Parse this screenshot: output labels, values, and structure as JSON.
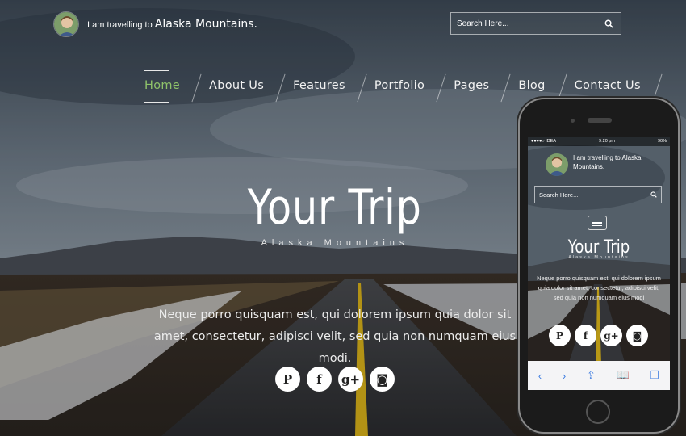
{
  "header": {
    "brand_prefix": "I am travelling to",
    "brand_strong": "Alaska Mountains.",
    "search_placeholder": "Search Here..."
  },
  "nav": {
    "items": [
      "Home",
      "About Us",
      "Features",
      "Portfolio",
      "Pages",
      "Blog",
      "Contact Us"
    ],
    "active": "Home"
  },
  "hero": {
    "title": "Your Trip",
    "subtitle": "Alaska Mountains",
    "lead": "Neque porro quisquam est, qui dolorem ipsum quia dolor sit amet, consectetur, adipisci velit, sed quia non numquam eius modi."
  },
  "social": {
    "icons": [
      "pinterest-icon",
      "facebook-icon",
      "google-plus-icon",
      "instagram-icon"
    ],
    "glyphs": [
      "P",
      "f",
      "g+",
      "◙"
    ]
  },
  "phone": {
    "status_carrier": "●●●●○ IDEA",
    "status_time": "9:20 pm",
    "status_battery": "90%",
    "brand_prefix": "I am travelling to",
    "brand_strong": "Alaska Mountains.",
    "search_placeholder": "Search Here...",
    "title": "Your Trip",
    "subtitle": "Alaska Mountains",
    "lead": "Neque porro quisquam est, qui dolorem ipsum quia dolor sit amet, consectetur, adipisci velit, sed quia non numquam eius modi",
    "toolbar": [
      "‹",
      "›",
      "⇪",
      "📖",
      "❐"
    ]
  },
  "colors": {
    "accent": "#8fc36a",
    "road_line": "#d9b31a"
  }
}
